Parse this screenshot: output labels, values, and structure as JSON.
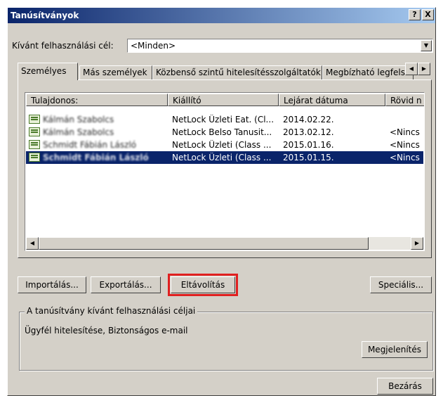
{
  "window": {
    "title": "Tanúsítványok",
    "help_label": "?",
    "close_label": "X"
  },
  "purpose": {
    "label": "Kívánt felhasználási cél:",
    "value": "<Minden>"
  },
  "tabs": [
    {
      "label": "Személyes"
    },
    {
      "label": "Más személyek"
    },
    {
      "label": "Közbenső szintű hitelesítésszolgáltatók"
    },
    {
      "label": "Megbízható legfelső"
    }
  ],
  "list": {
    "columns": [
      "Tulajdonos:",
      "Kiállító",
      "Lejárat dátuma",
      "Rövid n"
    ],
    "rows": [
      {
        "owner": "Kálmán Szabolcs",
        "issuer": "NetLock Üzleti Eat. (Cl...",
        "expires": "2014.02.22.",
        "short": "",
        "selected": false
      },
      {
        "owner": "Kálmán Szabolcs",
        "issuer": "NetLock Belso Tanusit...",
        "expires": "2013.02.12.",
        "short": "<Nincs",
        "selected": false
      },
      {
        "owner": "Schmidt Fábián László",
        "issuer": "NetLock Üzleti (Class ...",
        "expires": "2015.01.16.",
        "short": "<Nincs",
        "selected": false
      },
      {
        "owner": "Schmidt Fábián László",
        "issuer": "NetLock Üzleti (Class ...",
        "expires": "2015.01.15.",
        "short": "<Nincs",
        "selected": true
      }
    ]
  },
  "buttons": {
    "import": "Importálás...",
    "export": "Exportálás...",
    "remove": "Eltávolítás",
    "advanced": "Speciális...",
    "view": "Megjelenítés",
    "close": "Bezárás"
  },
  "purposes_group": {
    "legend": "A tanúsítvány kívánt felhasználási céljai",
    "text": "Ügyfél hitelesítése, Biztonságos e-mail"
  },
  "colors": {
    "titlebar_start": "#0a246a",
    "titlebar_end": "#a6caf0",
    "selection": "#0a246a",
    "highlight_box": "#e02020",
    "dialog_face": "#d4d0c8"
  }
}
